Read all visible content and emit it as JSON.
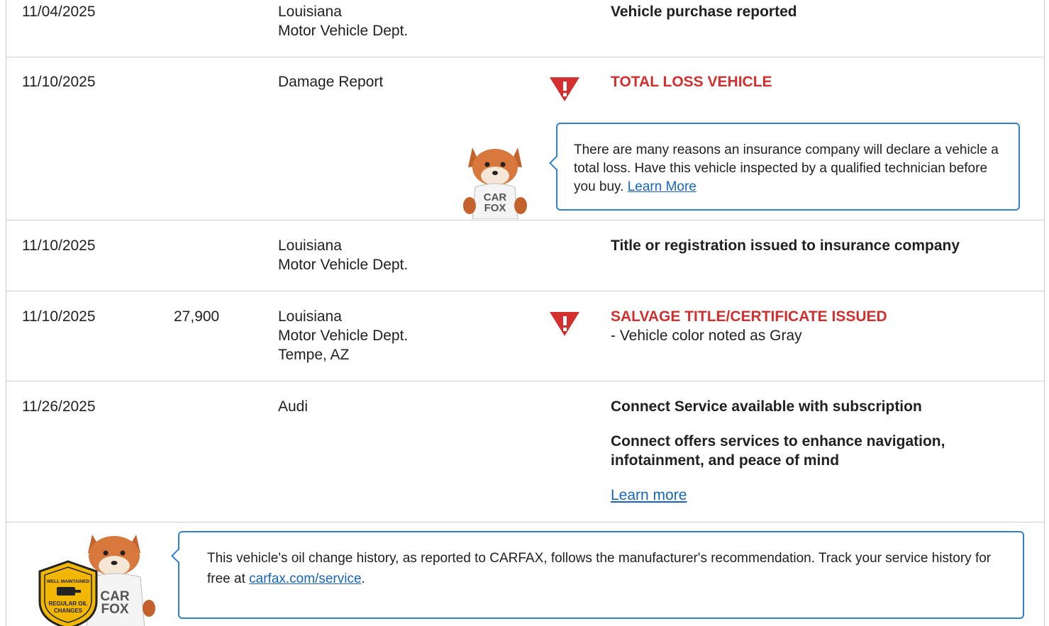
{
  "records": [
    {
      "date": "11/04/2025",
      "source_line1": "Louisiana",
      "source_line2": "Motor Vehicle Dept.",
      "detail": "Vehicle purchase reported"
    },
    {
      "date": "11/10/2025",
      "source": "Damage Report",
      "detail": "TOTAL LOSS VEHICLE",
      "tip": "There are many reasons an insurance company will declare a vehicle a total loss. Have this vehicle inspected by a qualified technician before you buy.",
      "tip_link": "Learn More"
    },
    {
      "date": "11/10/2025",
      "source_line1": "Louisiana",
      "source_line2": "Motor Vehicle Dept.",
      "detail": "Title or registration issued to insurance company"
    },
    {
      "date": "11/10/2025",
      "odometer": "27,900",
      "source_line1": "Louisiana",
      "source_line2": "Motor Vehicle Dept.",
      "source_line3": "Tempe, AZ",
      "detail": "SALVAGE TITLE/CERTIFICATE ISSUED",
      "detail_sub": "- Vehicle color noted as Gray"
    },
    {
      "date": "11/26/2025",
      "source": "Audi",
      "detail": "Connect Service available with subscription",
      "detail_2": "Connect offers services to enhance navigation, infotainment, and peace of mind",
      "link": "Learn more"
    }
  ],
  "oil_note": {
    "text": "This vehicle's oil change history, as reported to CARFAX, follows the manufacturer's recommendation. Track your service history for free at",
    "link": "carfax.com/service",
    "suffix": "."
  },
  "badge": {
    "top": "WELL MAINTAINED",
    "bottom_1": "REGULAR OIL",
    "bottom_2": "CHANGES"
  },
  "mascot_shirt": {
    "line1": "CAR",
    "line2": "FOX"
  },
  "colors": {
    "alert_red": "#d32f2f",
    "link_blue": "#1565c0",
    "callout_border": "#2f80d1",
    "badge_gold": "#f2b705"
  }
}
